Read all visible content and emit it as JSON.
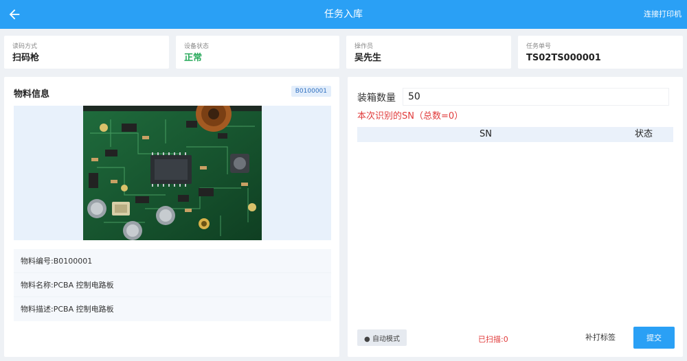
{
  "header": {
    "title": "任务入库",
    "printer_link": "连接打印机",
    "back_icon": "arrow-left-icon"
  },
  "info_cards": [
    {
      "label": "读码方式",
      "value": "扫码枪"
    },
    {
      "label": "设备状态",
      "value": "正常",
      "color": "#27a95a"
    },
    {
      "label": "操作员",
      "value": "吴先生"
    },
    {
      "label": "任务单号",
      "value": "TS02TS000001"
    }
  ],
  "material": {
    "title": "物料信息",
    "code_badge": "B0100001",
    "image_icon": "pcb-board-image",
    "details": [
      "物料编号:B0100001",
      "物料名称:PCBA 控制电路板",
      "物料描述:PCBA 控制电路板"
    ]
  },
  "packing": {
    "qty_label": "装箱数量",
    "qty_value": "50",
    "sn_caption": "本次识别的SN（总数=0）",
    "columns": [
      "SN",
      "状态"
    ],
    "rows": []
  },
  "footer": {
    "auto_mode": "● 自动模式",
    "scanned": "已扫描:0",
    "reprint": "补打标签",
    "submit": "提交"
  },
  "colors": {
    "primary": "#2aa0f5",
    "ok": "#27a95a",
    "alert": "#e03a3a"
  }
}
